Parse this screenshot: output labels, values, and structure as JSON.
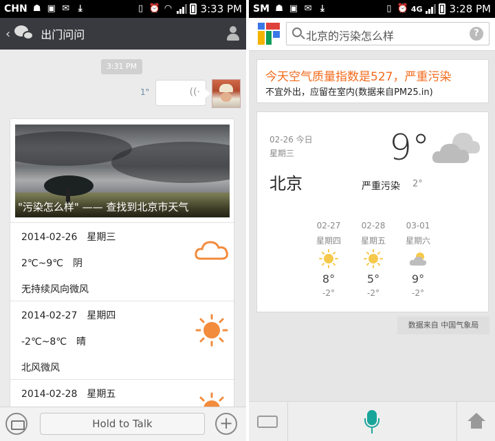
{
  "left": {
    "status": {
      "carrier": "CHN",
      "time": "3:33 PM"
    },
    "header": {
      "title": "出门问问"
    },
    "chat": {
      "timestamp": "3:31 PM",
      "voice_duration": "1\""
    },
    "card": {
      "caption": "\"污染怎么样\" —— 查找到北京市天气",
      "days": [
        {
          "date_line": "2014-02-26　星期三",
          "temp_line": "2℃~9℃　阴",
          "wind_line": "无持续风向微风",
          "icon": "cloud-icon"
        },
        {
          "date_line": "2014-02-27　星期四",
          "temp_line": "-2℃~8℃　晴",
          "wind_line": "北风微风",
          "icon": "sun-icon"
        },
        {
          "date_line": "2014-02-28　星期五",
          "temp_line": "",
          "wind_line": "",
          "icon": "sun-icon"
        }
      ]
    },
    "input": {
      "hold_to_talk": "Hold to Talk"
    }
  },
  "right": {
    "status": {
      "carrier": "SM",
      "network": "4G",
      "time": "3:28 PM"
    },
    "search": {
      "query": "北京的污染怎么样",
      "help": "?"
    },
    "air": {
      "title": "今天空气质量指数是527，严重污染",
      "subtitle": "不宜外出，应留在室内(数据来自PM25.in)"
    },
    "weather": {
      "date": "02-26 今日",
      "weekday": "星期三",
      "city": "北京",
      "temp": "9°",
      "condition": "严重污染",
      "low": "2°",
      "forecast": [
        {
          "date": "02-27",
          "weekday": "星期四",
          "high": "8°",
          "low": "-2°",
          "icon": "sun-icon"
        },
        {
          "date": "02-28",
          "weekday": "星期五",
          "high": "5°",
          "low": "-2°",
          "icon": "sun-icon"
        },
        {
          "date": "03-01",
          "weekday": "星期六",
          "high": "9°",
          "low": "-2°",
          "icon": "partly-cloudy-icon"
        }
      ],
      "source": "数据来自 中国气象局"
    },
    "colors": {
      "accent": "#f36a1b",
      "mic": "#1aa59a"
    }
  }
}
